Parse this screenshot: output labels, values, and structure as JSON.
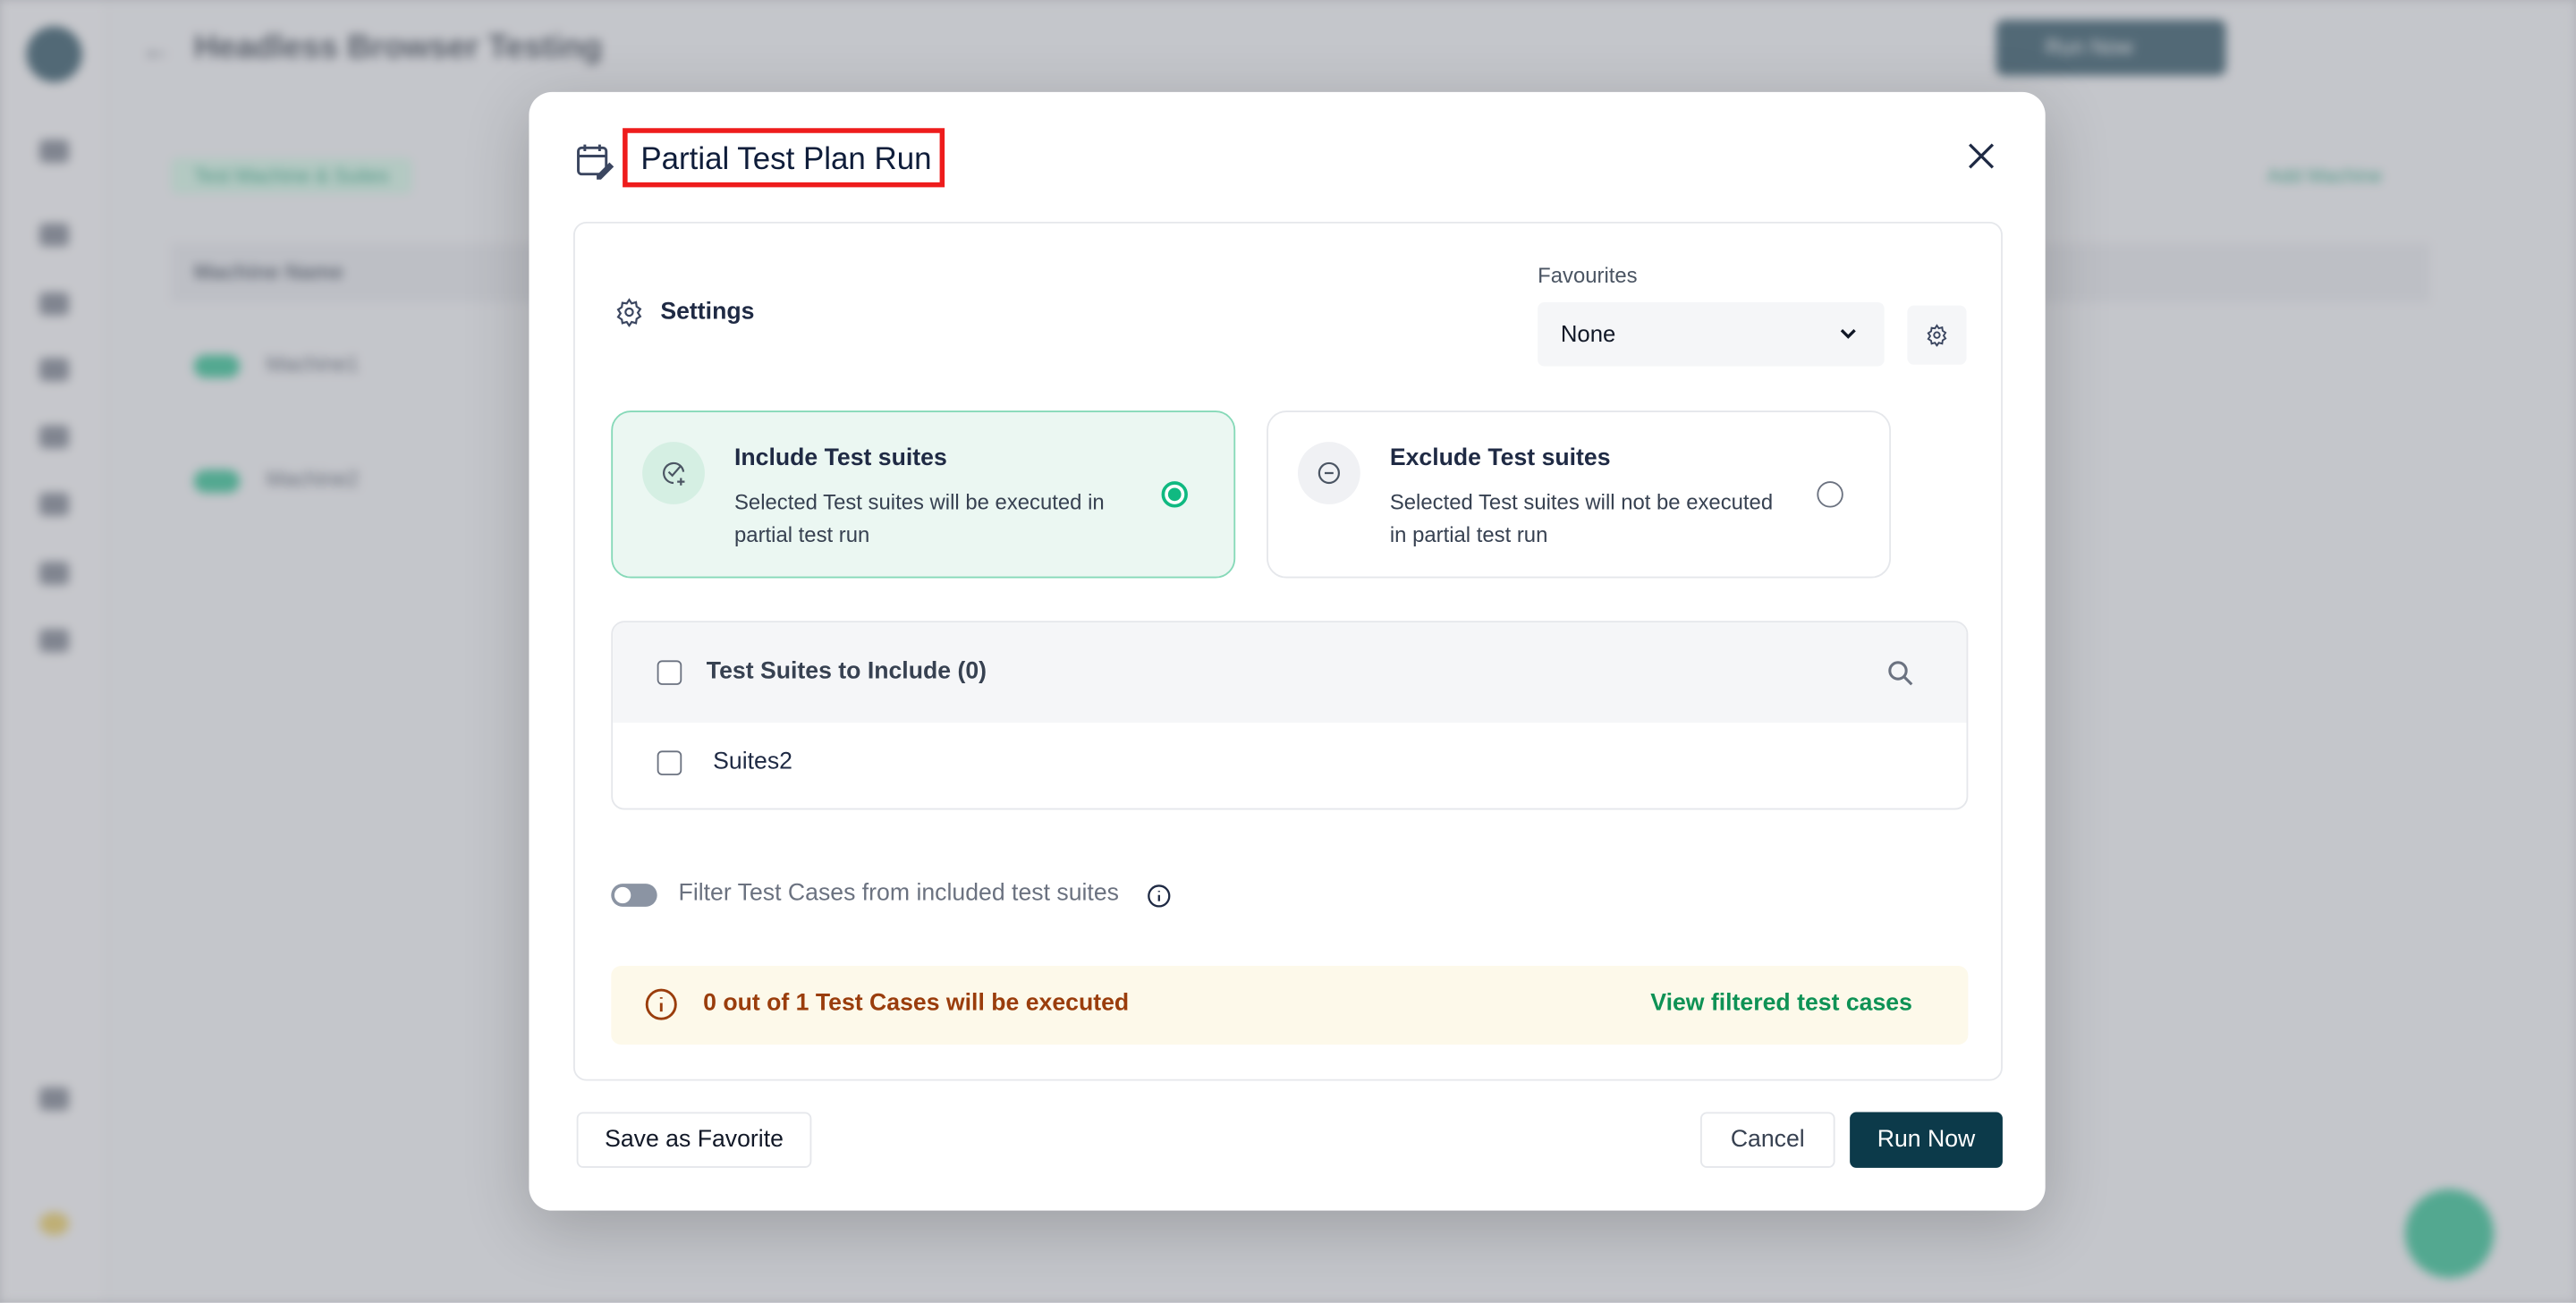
{
  "background": {
    "page_title": "Headless Browser Testing",
    "tab_label": "Test Machine & Suites",
    "table_header": "Machine Name",
    "rows": [
      "Machine1",
      "Machine2"
    ],
    "run_button": "Run Now",
    "add_machine": "Add Machine"
  },
  "modal": {
    "title": "Partial Test Plan Run",
    "settings_label": "Settings",
    "favourites_label": "Favourites",
    "favourites_selected": "None",
    "include_option": {
      "title": "Include Test suites",
      "description": "Selected Test suites will be executed in partial test run",
      "selected": true
    },
    "exclude_option": {
      "title": "Exclude Test suites",
      "description": "Selected Test suites will not be executed in partial test run",
      "selected": false
    },
    "suites_header": "Test Suites to Include (0)",
    "suites": [
      {
        "name": "Suites2",
        "checked": false
      }
    ],
    "filter_toggle_label": "Filter Test Cases from included test suites",
    "filter_toggle_on": false,
    "banner_message": "0 out of 1 Test Cases will be executed",
    "banner_link": "View filtered test cases",
    "save_favorite_label": "Save as Favorite",
    "cancel_label": "Cancel",
    "run_now_label": "Run Now"
  },
  "colors": {
    "accent": "#10b981",
    "primary_button": "#0c3a4a",
    "warning_text": "#9a3d0c",
    "link": "#0e9255",
    "highlight_box": "#ee1c1c"
  }
}
